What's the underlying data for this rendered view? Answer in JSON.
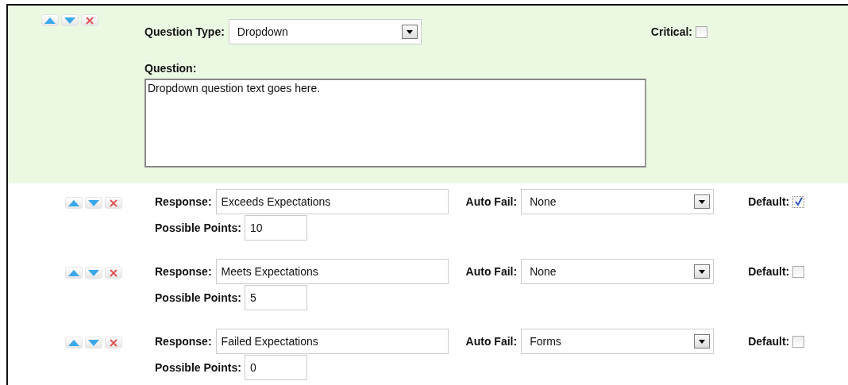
{
  "question": {
    "type_label": "Question Type:",
    "type_value": "Dropdown",
    "critical_label": "Critical:",
    "critical": false,
    "question_label": "Question:",
    "question_text": "Dropdown question text goes here."
  },
  "responses": [
    {
      "response_label": "Response:",
      "response": "Exceeds Expectations",
      "auto_fail_label": "Auto Fail:",
      "auto_fail": "None",
      "default_label": "Default:",
      "default": true,
      "points_label": "Possible Points:",
      "points": "10"
    },
    {
      "response_label": "Response:",
      "response": "Meets Expectations",
      "auto_fail_label": "Auto Fail:",
      "auto_fail": "None",
      "default_label": "Default:",
      "default": false,
      "points_label": "Possible Points:",
      "points": "5"
    },
    {
      "response_label": "Response:",
      "response": "Failed Expectations",
      "auto_fail_label": "Auto Fail:",
      "auto_fail": "Forms",
      "default_label": "Default:",
      "default": false,
      "points_label": "Possible Points:",
      "points": "0"
    }
  ]
}
